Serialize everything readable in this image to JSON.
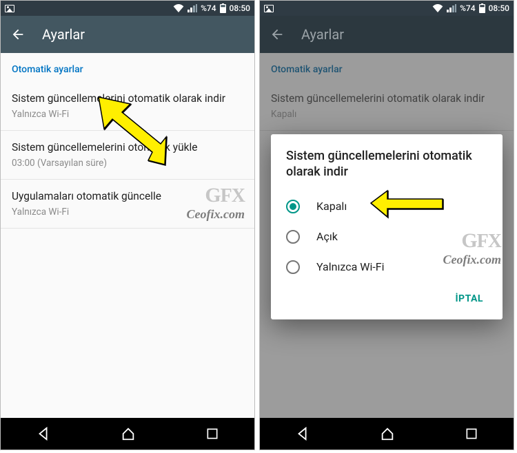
{
  "status": {
    "battery_text": "%74",
    "time": "08:50"
  },
  "appbar": {
    "title": "Ayarlar"
  },
  "section": {
    "header": "Otomatik ayarlar"
  },
  "settings": [
    {
      "primary": "Sistem güncellemelerini otomatik olarak indir",
      "secondary": "Yalnızca Wi-Fi"
    },
    {
      "primary": "Sistem güncellemelerini otomatik yükle",
      "secondary": "03:00 (Varsayılan süre)"
    },
    {
      "primary": "Uygulamaları otomatik güncelle",
      "secondary": "Yalnızca Wi-Fi"
    }
  ],
  "settings_right": [
    {
      "primary": "Sistem güncellemelerini otomatik olarak indir",
      "secondary": "Kapalı"
    }
  ],
  "dialog": {
    "title": "Sistem güncellemelerini otomatik olarak indir",
    "options": [
      "Kapalı",
      "Açık",
      "Yalnızca Wi-Fi"
    ],
    "selected_index": 0,
    "cancel": "İPTAL"
  },
  "watermark": {
    "logo": "GFX",
    "site": "Ceofix.com"
  }
}
